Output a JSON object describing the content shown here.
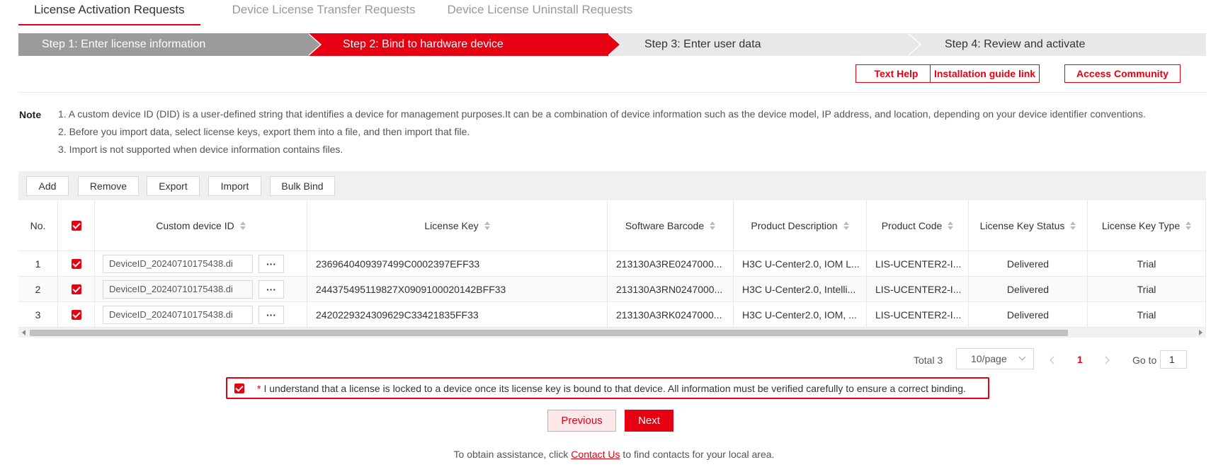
{
  "tabs": [
    {
      "label": "License Activation Requests",
      "active": true
    },
    {
      "label": "Device License Transfer Requests",
      "active": false
    },
    {
      "label": "Device License Uninstall Requests",
      "active": false
    }
  ],
  "steps": [
    {
      "label": "Step 1: Enter license information",
      "state": "done"
    },
    {
      "label": "Step 2: Bind to hardware device",
      "state": "current"
    },
    {
      "label": "Step 3: Enter user data",
      "state": "pending"
    },
    {
      "label": "Step 4: Review and activate",
      "state": "pending"
    }
  ],
  "help": {
    "text_help": "Text Help",
    "installation_guide": "Installation guide link",
    "access_community": "Access Community"
  },
  "note": {
    "title": "Note",
    "lines": [
      "1. A custom device ID (DID) is a user-defined string that identifies a device for management purposes.It can be a combination of device information such as the device model, IP address, and location, depending on your device identifier conventions.",
      "2. Before you import data, select license keys, export them into a file, and then import that file.",
      "3. Import is not supported when device information contains files."
    ]
  },
  "toolbar": {
    "add": "Add",
    "remove": "Remove",
    "export": "Export",
    "import": "Import",
    "bulk_bind": "Bulk Bind"
  },
  "table": {
    "headers": {
      "no": "No.",
      "custom_device_id": "Custom device ID",
      "license_key": "License Key",
      "software_barcode": "Software Barcode",
      "product_description": "Product Description",
      "product_code": "Product Code",
      "license_key_status": "License Key Status",
      "license_key_type": "License Key Type"
    },
    "rows": [
      {
        "no": "1",
        "device_id": "DeviceID_20240710175438.di",
        "license_key": "2369640409397499C0002397EFF33",
        "barcode": "213130A3RE0247000...",
        "description": "H3C U-Center2.0, IOM L...",
        "code": "LIS-UCENTER2-I...",
        "status": "Delivered",
        "type": "Trial"
      },
      {
        "no": "2",
        "device_id": "DeviceID_20240710175438.di",
        "license_key": "244375495119827X0909100020142BFF33",
        "barcode": "213130A3RN0247000...",
        "description": "H3C U-Center2.0, Intelli...",
        "code": "LIS-UCENTER2-I...",
        "status": "Delivered",
        "type": "Trial"
      },
      {
        "no": "3",
        "device_id": "DeviceID_20240710175438.di",
        "license_key": "2420229324309629C33421835FF33",
        "barcode": "213130A3RK0247000...",
        "description": "H3C U-Center2.0, IOM, ...",
        "code": "LIS-UCENTER2-I...",
        "status": "Delivered",
        "type": "Trial"
      }
    ],
    "dots_label": "···"
  },
  "pagination": {
    "total": "Total 3",
    "page_size": "10/page",
    "current_page": "1",
    "goto_label": "Go to",
    "goto_value": "1"
  },
  "agreement": {
    "star": "*",
    "text": "I understand that a license is locked to a device once its license key is bound to that device. All information must be verified carefully to ensure a correct binding."
  },
  "nav": {
    "previous": "Previous",
    "next": "Next"
  },
  "footer": {
    "prefix": "To obtain assistance, click ",
    "link": "Contact Us",
    "suffix": " to find contacts for your local area."
  },
  "colors": {
    "accent": "#e60012",
    "step_done": "#9b9b9b",
    "step_pending": "#e8e8e8"
  }
}
